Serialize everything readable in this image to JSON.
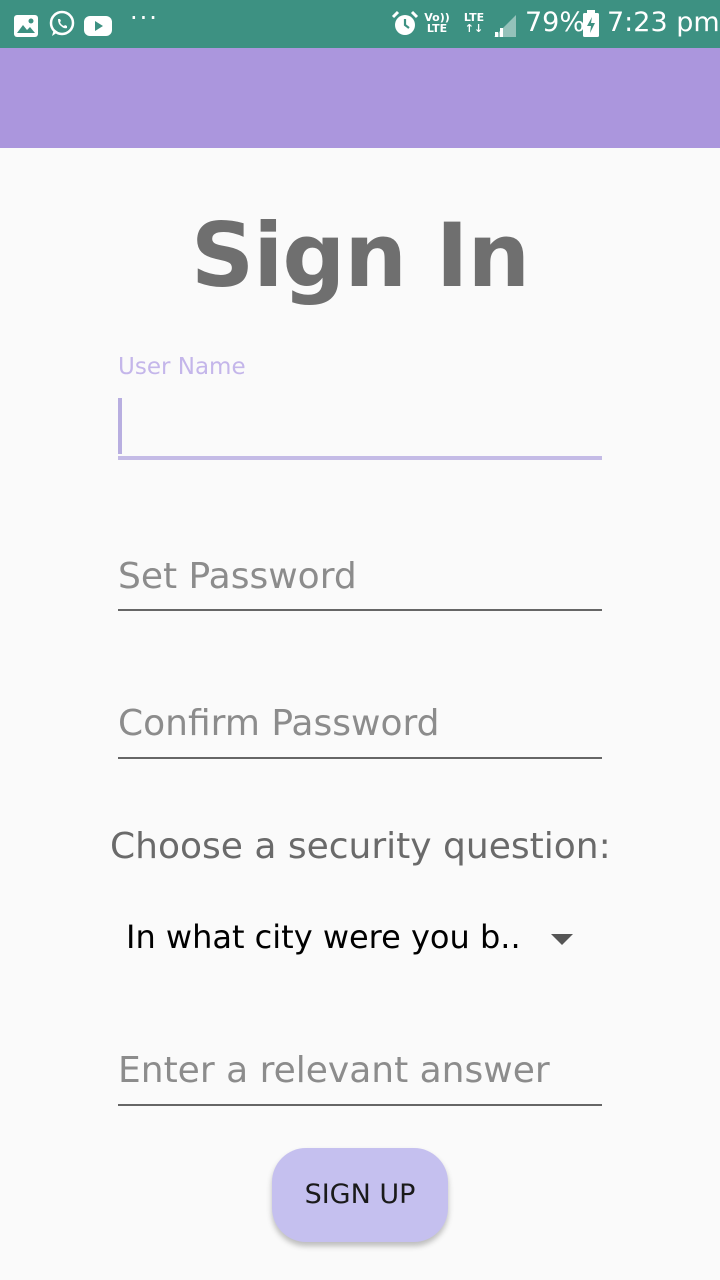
{
  "status_bar": {
    "battery": "79%",
    "time": "7:23 pm",
    "volte_top": "Vo))",
    "volte_bottom": "LTE",
    "lte": "LTE",
    "more": "···",
    "background_color": "#3d9182"
  },
  "app_bar": {
    "background_color": "#ab96dd"
  },
  "form": {
    "title": "Sign In",
    "username_label": "User Name",
    "username_value": "",
    "password_placeholder": "Set Password",
    "confirm_placeholder": "Confirm Password",
    "security_prompt": "Choose a security question:",
    "security_question_selected": "In what city were you b..",
    "answer_placeholder": "Enter a relevant answer",
    "signup_label": "SIGN UP",
    "accent_color": "#c5c0ef"
  }
}
